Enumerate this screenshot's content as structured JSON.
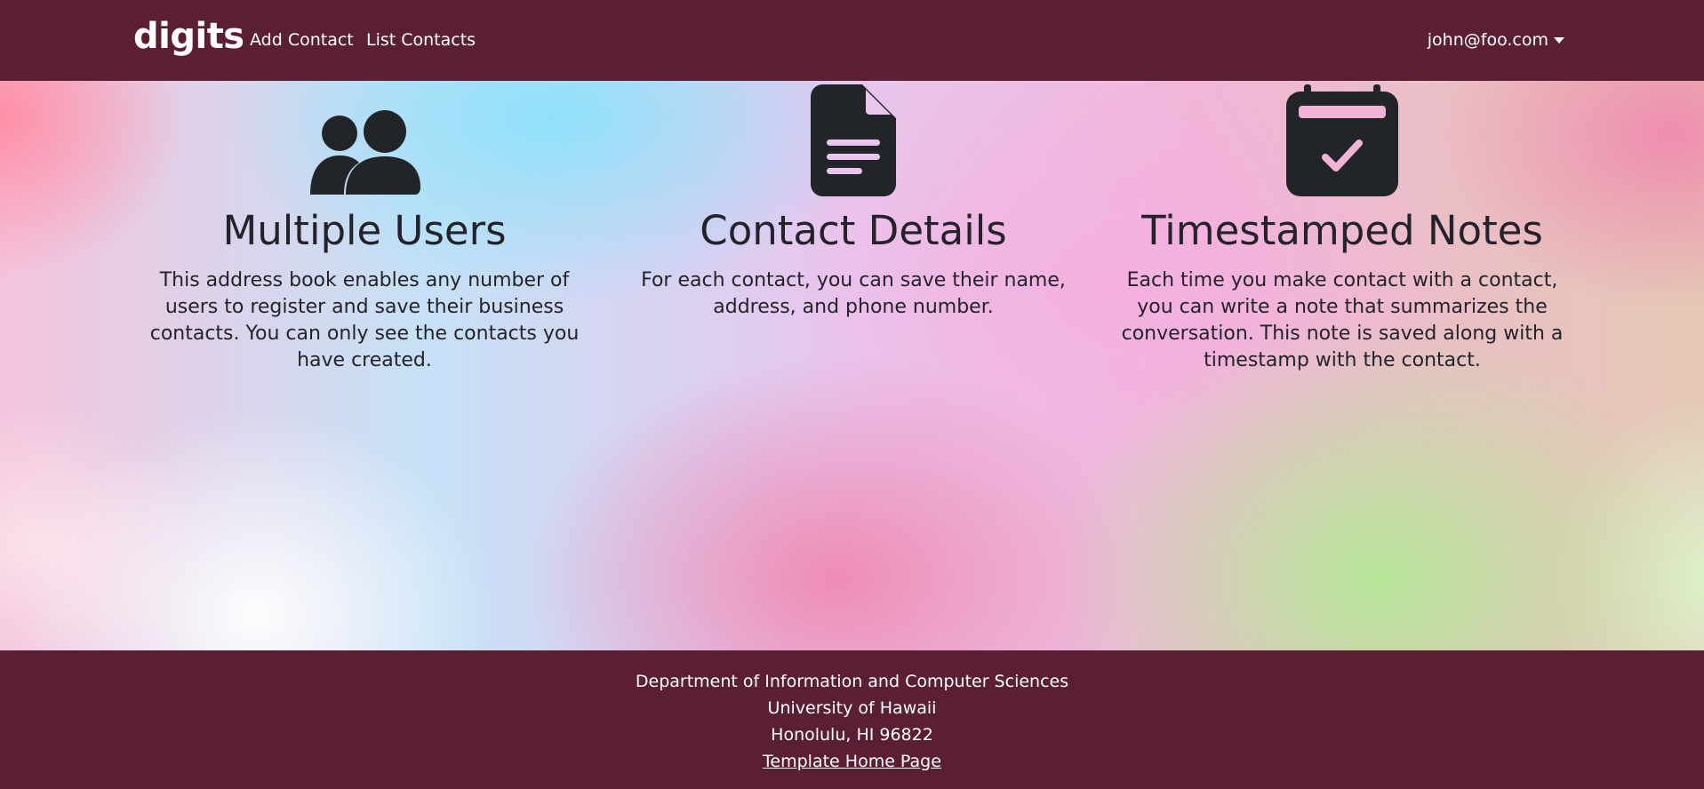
{
  "navbar": {
    "brand": "digits",
    "links": [
      {
        "label": "Add Contact"
      },
      {
        "label": "List Contacts"
      }
    ],
    "user_menu": {
      "label": "john@foo.com",
      "icon": "caret-down-icon"
    },
    "background_color": "#5b1f33"
  },
  "features": [
    {
      "icon": "users-icon",
      "title": "Multiple Users",
      "text": "This address book enables any number of users to register and save their business contacts. You can only see the contacts you have created."
    },
    {
      "icon": "file-text-icon",
      "title": "Contact Details",
      "text": "For each contact, you can save their name, address, and phone number."
    },
    {
      "icon": "calendar-check-icon",
      "title": "Timestamped Notes",
      "text": "Each time you make contact with a contact, you can write a note that summarizes the conversation. This note is saved along with a timestamp with the contact."
    }
  ],
  "footer": {
    "lines": [
      "Department of Information and Computer Sciences",
      "University of Hawaii",
      "Honolulu, HI 96822"
    ],
    "link_label": "Template Home Page",
    "background_color": "#5b1f33"
  },
  "colors": {
    "icon_dark": "#212529",
    "text_dark": "#24222a"
  }
}
